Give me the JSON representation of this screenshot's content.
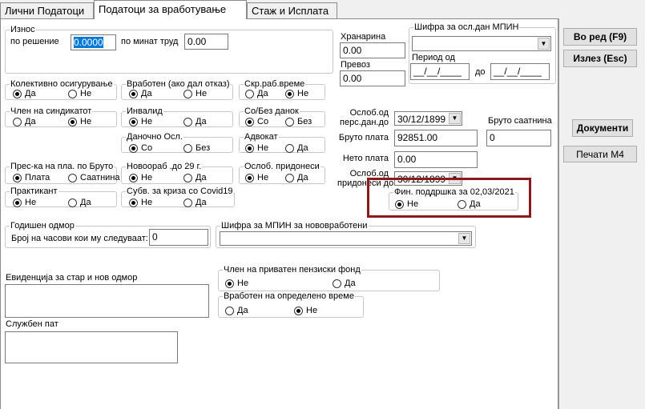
{
  "tabs": [
    "Лични Податоци",
    "Податоци за вработување",
    "Стаж и Исплата"
  ],
  "iznos": {
    "legend": "Износ",
    "po_resenie_label": "по решение",
    "po_resenie_value": "0.0000",
    "po_minat_trud_label": "по минат труд",
    "po_minat_trud_value": "0.00"
  },
  "hranarina": {
    "label": "Хранарина",
    "value": "0.00"
  },
  "prevoz": {
    "label": "Превоз",
    "value": "0.00"
  },
  "shifra_osl": {
    "legend": "Шифра за осл.дан МПИН",
    "value": "",
    "period_label": "Период од",
    "from": "__/__/____",
    "to_label": "до",
    "to": "__/__/____"
  },
  "groups": {
    "kolektivno": {
      "legend": "Колективно осигурување",
      "a": "Да",
      "b": "Не",
      "selected": "a"
    },
    "vraboten": {
      "legend": "Вработен (ако дал отказ)",
      "a": "Да",
      "b": "Не",
      "selected": "a"
    },
    "skr": {
      "legend": "Скр.раб.време",
      "a": "Да",
      "b": "Не",
      "selected": "b"
    },
    "chlen_sindikat": {
      "legend": "Член на синдикатот",
      "a": "Да",
      "b": "Не",
      "selected": "b"
    },
    "invalid": {
      "legend": "Инвалид",
      "a": "Не",
      "b": "Да",
      "selected": "a"
    },
    "so_bez_danok": {
      "legend": "Со/Без данок",
      "a": "Со",
      "b": "Без",
      "selected": "a"
    },
    "danochno": {
      "legend": "Даночно Осл.",
      "a": "Со",
      "b": "Без",
      "selected": "a"
    },
    "advokat": {
      "legend": "Адвокат",
      "a": "Не",
      "b": "Да",
      "selected": "a"
    },
    "pres_ka": {
      "legend": "Прес-ка на пла. по  Бруто",
      "a": "Плата",
      "b": "Саатнина",
      "selected": "a"
    },
    "novovrab": {
      "legend": "Новоораб .до 29 г.",
      "a": "Не",
      "b": "Да",
      "selected": "a"
    },
    "osl_pridonesi": {
      "legend": "Ослоб. придонеси",
      "a": "Не",
      "b": "Да",
      "selected": "a"
    },
    "praktikant": {
      "legend": "Практикант",
      "a": "Не",
      "b": "Да",
      "selected": "a"
    },
    "subv_covid": {
      "legend": "Субв. за криза со Covid19",
      "a": "Не",
      "b": "Да",
      "selected": "a"
    },
    "fin_poddrska": {
      "legend": "Фин. поддршка за 02,03/2021",
      "a": "Не",
      "b": "Да",
      "selected": "a"
    },
    "penziski": {
      "legend": "Член на приватен пензиски фонд",
      "a": "Не",
      "b": "Да",
      "selected": "a"
    },
    "opredeleno": {
      "legend": "Вработен на определено време",
      "a": "Да",
      "b": "Не",
      "selected": "b"
    }
  },
  "osl_pers": {
    "label1": "Ослоб.од",
    "label2": "перс.дан.до",
    "value": "30/12/1899"
  },
  "bruto_saatnina": {
    "label": "Бруто саатнина",
    "value": "0"
  },
  "bruto_plata": {
    "label": "Бруто плата",
    "value": "92851.00"
  },
  "neto_plata": {
    "label": "Нето плата",
    "value": "0.00"
  },
  "osl_prid": {
    "label1": "Ослоб.од",
    "label2": "придонеси до",
    "value": "30/12/1899"
  },
  "godishen": {
    "legend": "Годишен одмор",
    "label": "Број на часови кои му следуваат:",
    "value": "0"
  },
  "shifra_nov": {
    "legend": "Шифра за МПИН за нововработени",
    "value": ""
  },
  "evidencija_label": "Евиденција за стар и нов одмор",
  "sluzben_label": "Службен пат",
  "buttons": {
    "vo_red": "Во ред (F9)",
    "izlez": "Излез (Esc)",
    "dokumenti": "Документи",
    "pechati": "Печати М4"
  }
}
